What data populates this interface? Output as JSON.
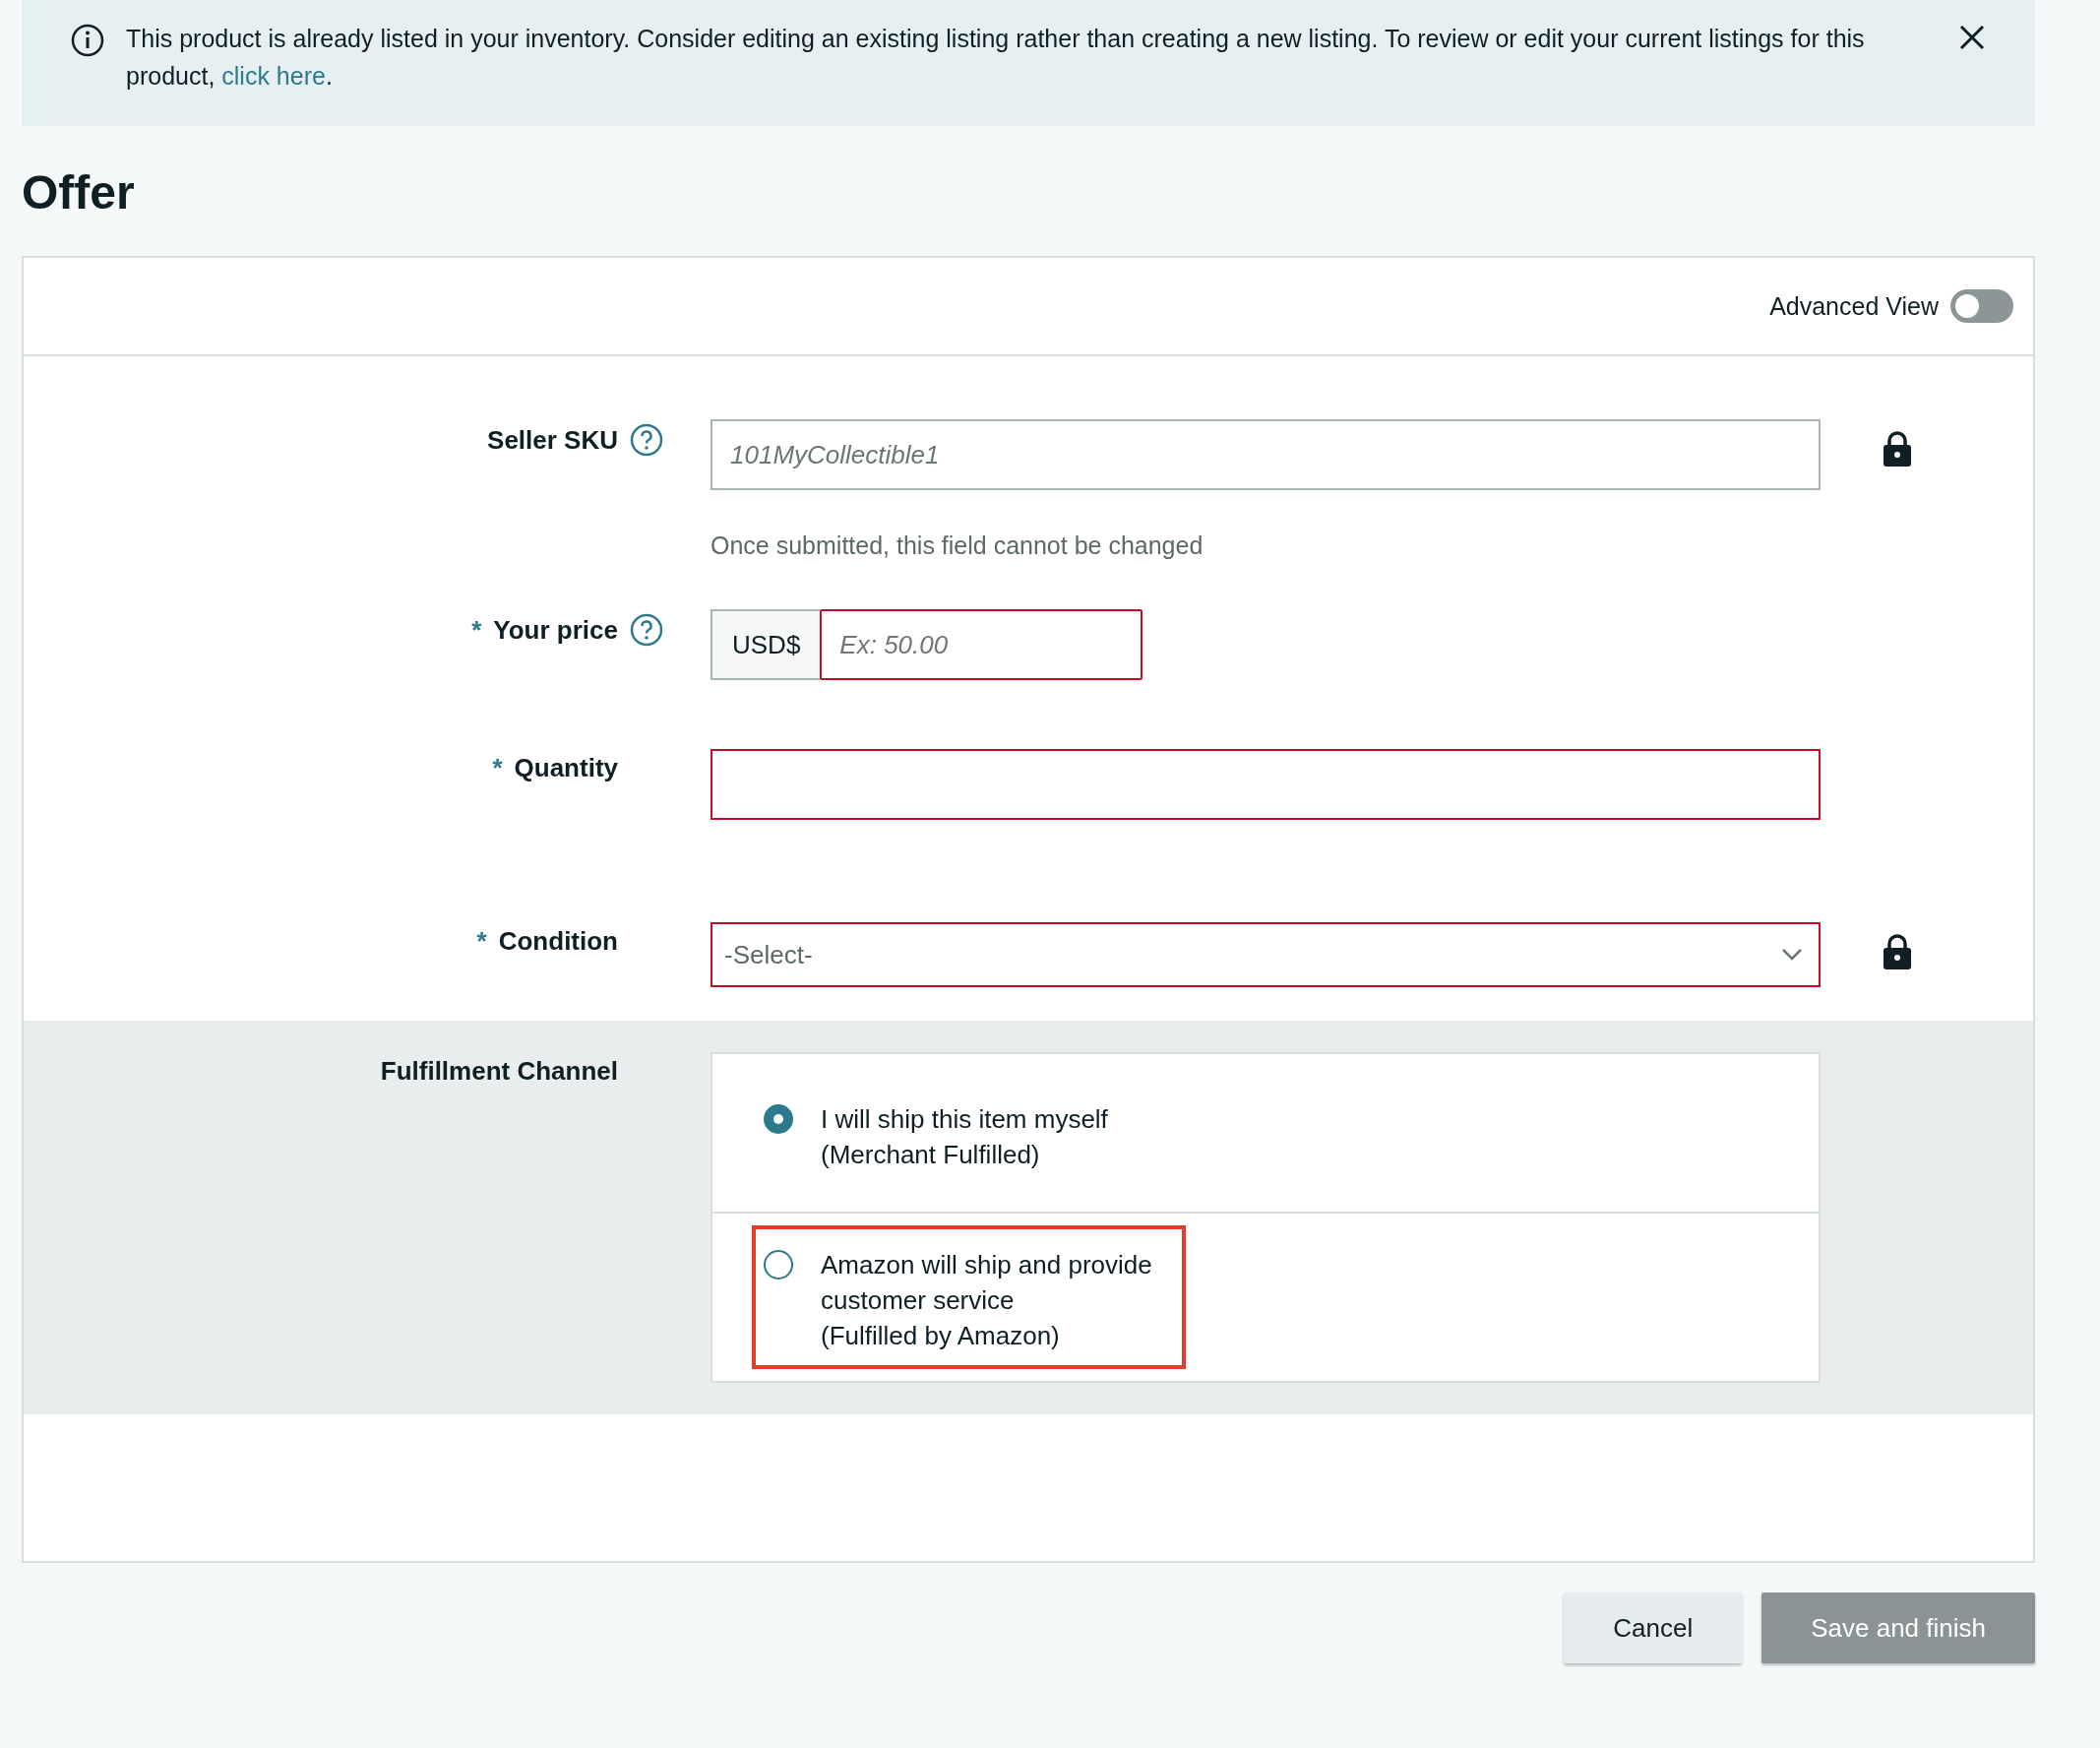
{
  "banner": {
    "text": "This product is already listed in your inventory. Consider editing an existing listing rather than creating a new listing. To review or edit your current listings for this product, ",
    "link": "click here",
    "after": "."
  },
  "title": "Offer",
  "advanced_view": {
    "label": "Advanced View",
    "on": false
  },
  "fields": [
    {
      "kind": "text",
      "label": "Seller SKU",
      "help": true,
      "value": "101MyCollectible1",
      "locked": true,
      "invalid": false,
      "note": "Once submitted, this field cannot be changed"
    },
    {
      "kind": "price",
      "label": "Your price",
      "marker": "*",
      "help": true,
      "prefix": "USD$",
      "placeholder": "Ex: 50.00",
      "locked": false,
      "invalid": true
    },
    {
      "kind": "text",
      "label": "Quantity",
      "marker": "*",
      "help": false,
      "locked": false,
      "invalid": true
    },
    {
      "kind": "select",
      "label": "Condition",
      "marker": "*",
      "help": false,
      "value": "-Select-",
      "locked": true,
      "invalid": true
    }
  ],
  "fulfillment": {
    "label": "Fulfillment Channel",
    "options": [
      {
        "lines": [
          "I will ship this item myself",
          "(Merchant Fulfilled)"
        ],
        "selected": true,
        "highlighted": false
      },
      {
        "lines": [
          "Amazon will ship and provide",
          "customer service",
          "(Fulfilled by Amazon)"
        ],
        "selected": false,
        "highlighted": true
      }
    ]
  },
  "buttons": [
    {
      "label": "Cancel",
      "kind": "secondary"
    },
    {
      "label": "Save and finish",
      "kind": "primary"
    }
  ]
}
